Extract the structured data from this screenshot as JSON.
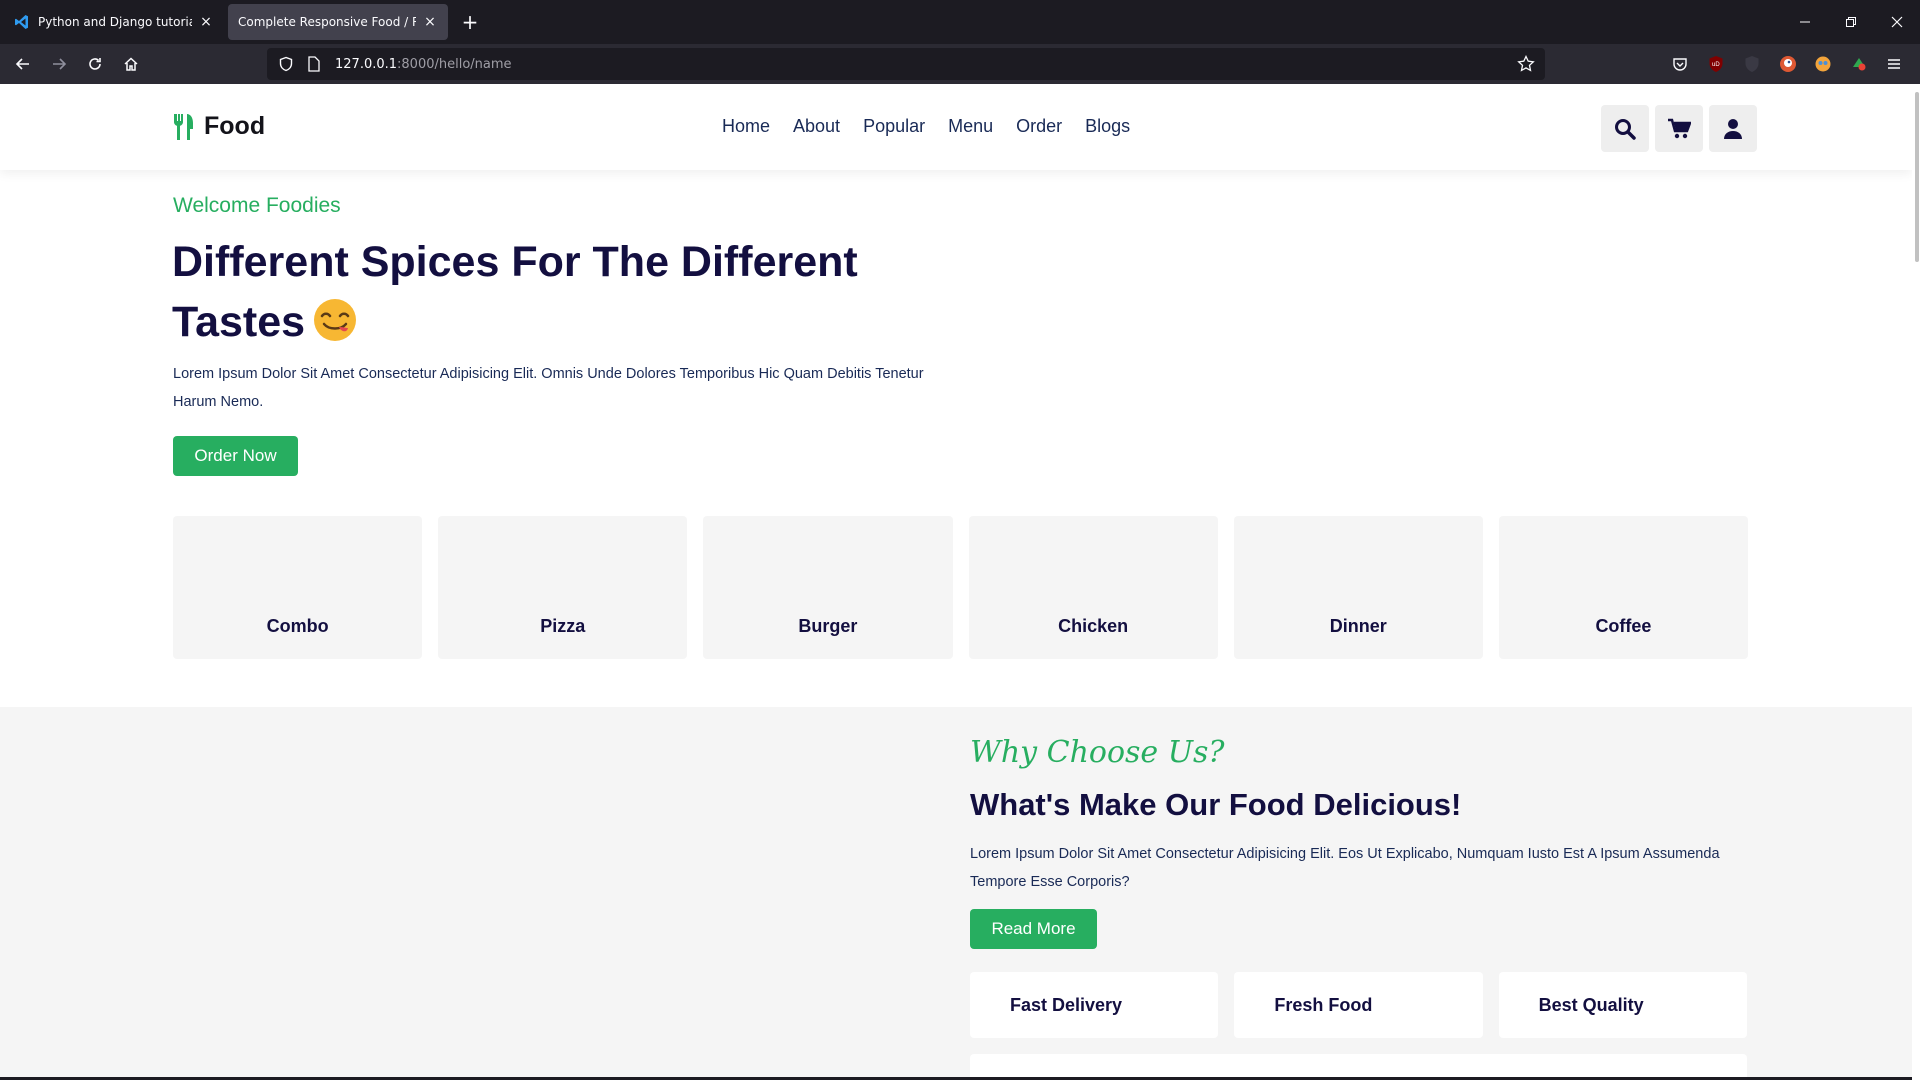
{
  "browser": {
    "tabs": [
      {
        "title": "Python and Django tutorial in V",
        "active": false
      },
      {
        "title": "Complete Responsive Food / Restur",
        "active": true
      }
    ],
    "url_host": "127.0.0.1",
    "url_path": ":8000/hello/name"
  },
  "site": {
    "logo_text": "Food",
    "menu": [
      "Home",
      "About",
      "Popular",
      "Menu",
      "Order",
      "Blogs"
    ],
    "hero": {
      "subtitle": "Welcome Foodies",
      "title": "Different Spices For The Different Tastes",
      "text": "Lorem Ipsum Dolor Sit Amet Consectetur Adipisicing Elit. Omnis Unde Dolores Temporibus Hic Quam Debitis Tenetur Harum Nemo.",
      "button": "Order Now"
    },
    "categories": [
      "Combo",
      "Pizza",
      "Burger",
      "Chicken",
      "Dinner",
      "Coffee"
    ],
    "why": {
      "subtitle": "Why Choose Us?",
      "title": "What's Make Our Food Delicious!",
      "text": "Lorem Ipsum Dolor Sit Amet Consectetur Adipisicing Elit. Eos Ut Explicabo, Numquam Iusto Est A Ipsum Assumenda Tempore Esse Corporis?",
      "button": "Read More",
      "features": [
        "Fast Delivery",
        "Fresh Food",
        "Best Quality"
      ]
    }
  },
  "colors": {
    "accent": "#27ae60",
    "heading": "#130f40",
    "text": "#192a56"
  }
}
